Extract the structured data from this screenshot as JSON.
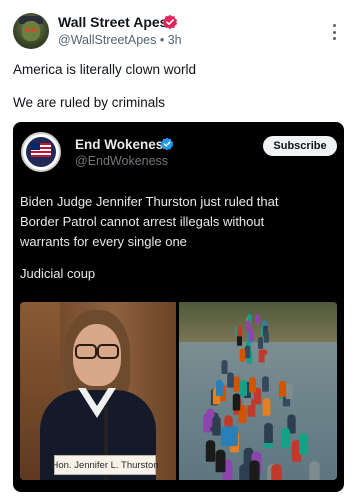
{
  "post": {
    "author": {
      "name": "Wall Street Apes",
      "handle": "@WallStreetApes",
      "time": "3h",
      "handle_time": "@WallStreetApes • 3h",
      "verified_icon": "verified-badge-icon",
      "verified_color": "#e0245e"
    },
    "more_icon": "more-options-icon",
    "text_lines": [
      "America is literally clown world",
      "We are ruled by criminals"
    ],
    "quote": {
      "author": {
        "name": "End Wokeness",
        "handle": "@EndWokeness",
        "verified_color": "#1d9bf0",
        "avatar_text": "AMERICA FIRST"
      },
      "subscribe_label": "Subscribe",
      "text_lines": [
        "Biden Judge Jennifer Thurston just ruled that",
        "Border Patrol cannot arrest illegals without",
        "warrants for every single one",
        "Judicial coup"
      ],
      "media": {
        "left_caption": "Hon. Jennifer L. Thurston"
      }
    }
  },
  "colors": {
    "text_primary": "#0f1419",
    "text_secondary": "#536471",
    "quote_background": "#000000",
    "quote_text": "#e7e9ea"
  }
}
